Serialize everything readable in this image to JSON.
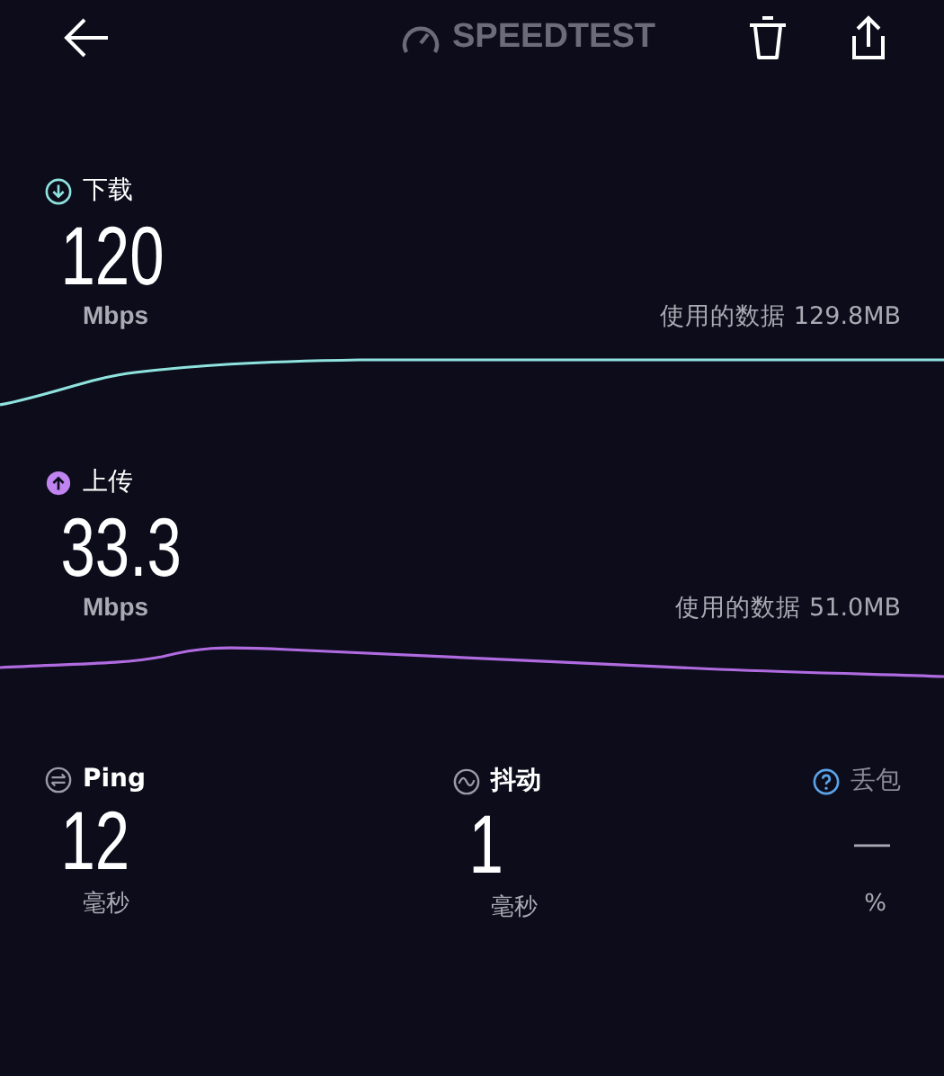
{
  "header": {
    "title": "SPEEDTEST"
  },
  "results": [
    {
      "kind": "download",
      "label": "下载",
      "value": "120",
      "unit": "Mbps",
      "data_used": "使用的数据 129.8MB"
    },
    {
      "kind": "upload",
      "label": "上传",
      "value": "33.3",
      "unit": "Mbps",
      "data_used": "使用的数据 51.0MB"
    }
  ],
  "stats": [
    {
      "kind": "ping",
      "label": "Ping",
      "value": "12",
      "unit": "毫秒"
    },
    {
      "kind": "jitter",
      "label": "抖动",
      "value": "1",
      "unit": "毫秒"
    },
    {
      "kind": "loss",
      "label": "丢包",
      "value": "—",
      "unit": "%"
    }
  ]
}
